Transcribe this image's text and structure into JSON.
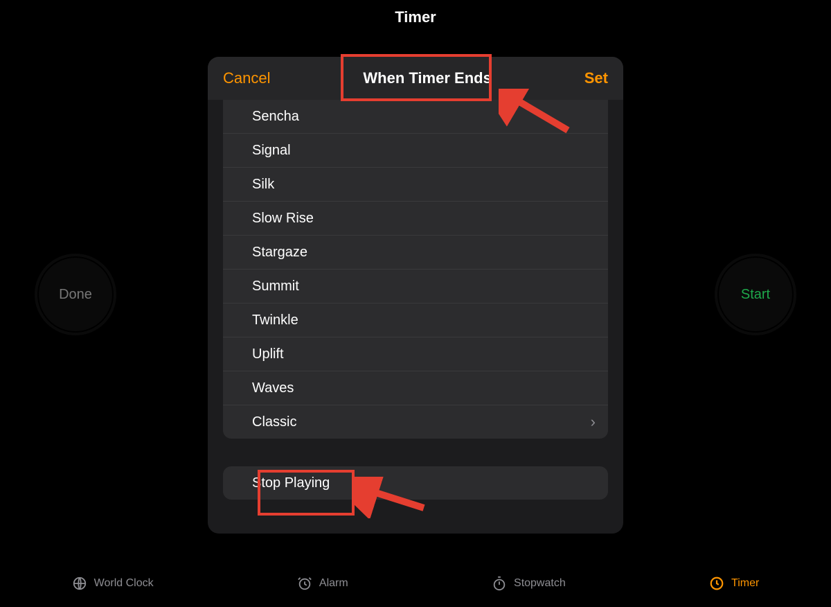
{
  "header": {
    "title": "Timer"
  },
  "controls": {
    "done_label": "Done",
    "start_label": "Start"
  },
  "modal": {
    "cancel_label": "Cancel",
    "title": "When Timer Ends",
    "set_label": "Set",
    "sounds": [
      {
        "label": "Sencha"
      },
      {
        "label": "Signal"
      },
      {
        "label": "Silk"
      },
      {
        "label": "Slow Rise"
      },
      {
        "label": "Stargaze"
      },
      {
        "label": "Summit"
      },
      {
        "label": "Twinkle"
      },
      {
        "label": "Uplift"
      },
      {
        "label": "Waves"
      },
      {
        "label": "Classic",
        "disclosure": true
      }
    ],
    "stop_playing_label": "Stop Playing"
  },
  "tabs": {
    "world_clock": "World Clock",
    "alarm": "Alarm",
    "stopwatch": "Stopwatch",
    "timer": "Timer"
  },
  "colors": {
    "accent": "#ff9500",
    "start_green": "#1ea84b",
    "annotation_red": "#e53e30"
  }
}
